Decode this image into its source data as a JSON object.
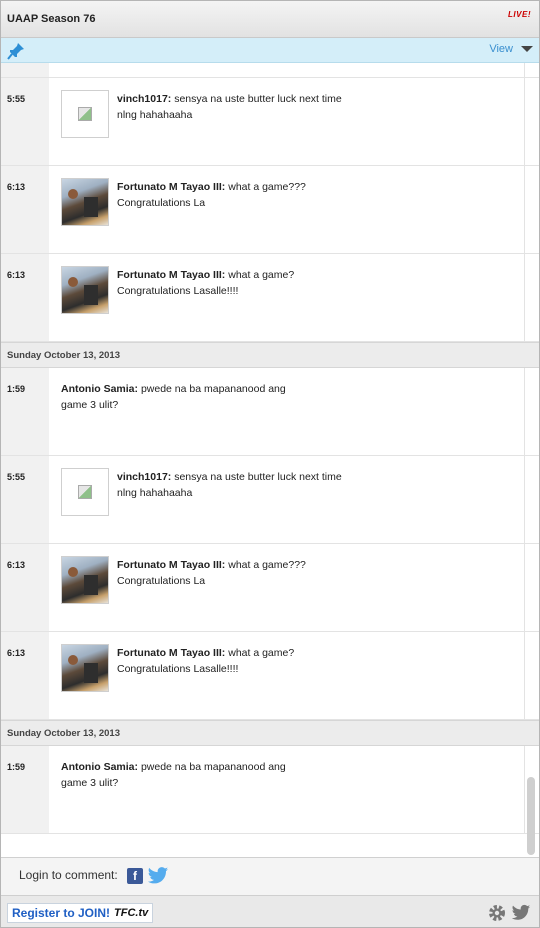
{
  "header": {
    "title": "UAAP Season 76",
    "live": "LIVE!"
  },
  "toolbar": {
    "view_label": "View"
  },
  "feed": [
    {
      "kind": "msg",
      "time": "5:55",
      "avatar": "broken",
      "author": "vinch1017:",
      "text": "sensya na uste butter luck next time nlng hahahaaha"
    },
    {
      "kind": "msg",
      "time": "6:13",
      "avatar": "photo",
      "author": "Fortunato M Tayao III:",
      "text": "what a game??? Congratulations La"
    },
    {
      "kind": "msg",
      "time": "6:13",
      "avatar": "photo",
      "author": "Fortunato M Tayao III:",
      "text": "what a game? Congratulations Lasalle!!!!"
    },
    {
      "kind": "day",
      "label": "Sunday October 13, 2013"
    },
    {
      "kind": "msg",
      "time": "1:59",
      "avatar": "none",
      "author": "Antonio Samia:",
      "text": "pwede na ba mapananood ang game 3 ulit?"
    },
    {
      "kind": "msg",
      "time": "5:55",
      "avatar": "broken",
      "author": "vinch1017:",
      "text": "sensya na uste butter luck next time nlng hahahaaha"
    },
    {
      "kind": "msg",
      "time": "6:13",
      "avatar": "photo",
      "author": "Fortunato M Tayao III:",
      "text": "what a game??? Congratulations La"
    },
    {
      "kind": "msg",
      "time": "6:13",
      "avatar": "photo",
      "author": "Fortunato M Tayao III:",
      "text": "what a game? Congratulations Lasalle!!!!"
    },
    {
      "kind": "day",
      "label": "Sunday October 13, 2013"
    },
    {
      "kind": "msg",
      "time": "1:59",
      "avatar": "none",
      "author": "Antonio Samia:",
      "text": "pwede na ba mapananood ang game 3 ulit?"
    }
  ],
  "footer": {
    "login_label": "Login to comment:",
    "facebook_glyph": "f"
  },
  "bottom": {
    "register_label": "Register to JOIN!",
    "brand": "TFC.tv"
  },
  "icons": {
    "pin": "pin-icon",
    "facebook": "facebook-icon",
    "twitter": "twitter-icon",
    "gear": "gear-icon"
  },
  "colors": {
    "accent": "#3a8fcf",
    "toolbar_bg": "#d4eef9",
    "live": "#cc0000",
    "facebook": "#3b5998",
    "twitter": "#55acee"
  }
}
